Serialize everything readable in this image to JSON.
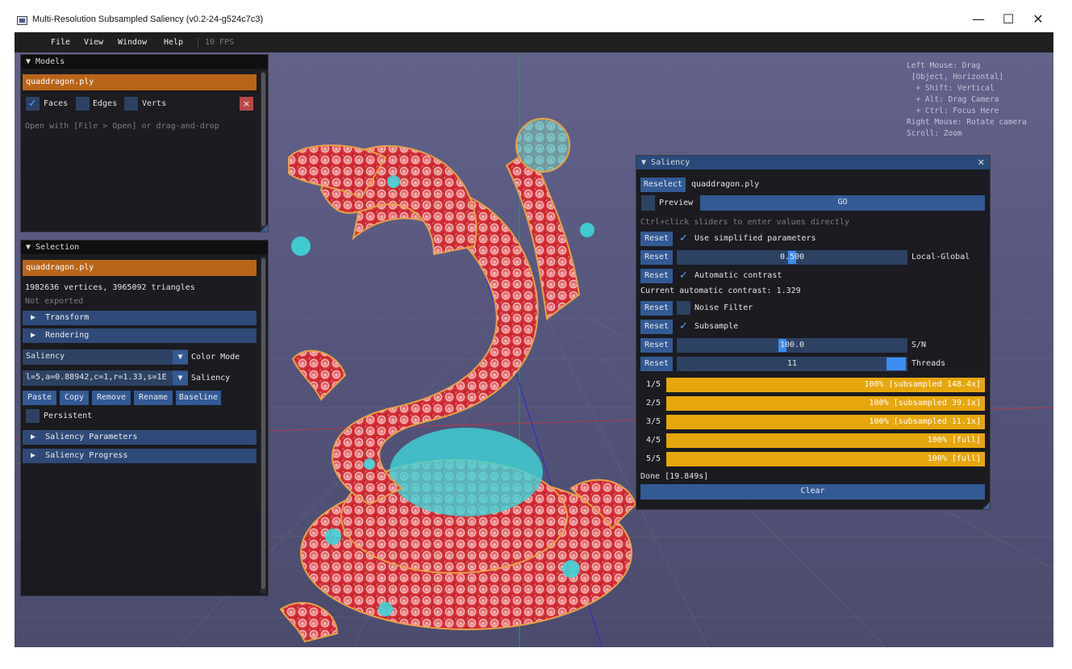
{
  "window": {
    "title": "Multi-Resolution Subsampled Saliency (v0.2-24-g524c7c3)",
    "minimize": "—",
    "maximize": "☐",
    "close": "✕"
  },
  "menu": {
    "items": [
      "File",
      "View",
      "Window",
      "Help"
    ],
    "fps": "10 FPS"
  },
  "help_text": "Left Mouse: Drag\n [Object, Horizontal]\n  + Shift: Vertical\n  + Alt: Drag Camera\n  + Ctrl: Focus Here\nRight Mouse: Rotate camera\nScroll: Zoom",
  "models": {
    "title": "Models",
    "selected_model": "quaddragon.ply",
    "faces": {
      "label": "Faces",
      "checked": true
    },
    "edges": {
      "label": "Edges",
      "checked": false
    },
    "verts": {
      "label": "Verts",
      "checked": false
    },
    "remove_glyph": "×",
    "hint": "Open with [File > Open] or drag-and-drop"
  },
  "selection": {
    "title": "Selection",
    "model": "quaddragon.ply",
    "stats": "1982636 vertices, 3965092 triangles",
    "export_status": "Not exported",
    "transform": "Transform",
    "rendering": "Rendering",
    "color_mode_value": "Saliency",
    "color_mode_label": "Color Mode",
    "saliency_value": "l=5,a=0.88942,c=1,r=1.33,s=1E",
    "saliency_label": "Saliency",
    "buttons": [
      "Paste",
      "Copy",
      "Remove",
      "Rename",
      "Baseline"
    ],
    "persistent": "Persistent",
    "saliency_parameters": "Saliency Parameters",
    "saliency_progress": "Saliency Progress"
  },
  "saliency": {
    "title": "Saliency",
    "reselect": "Reselect",
    "model": "quaddragon.ply",
    "preview": "Preview",
    "go": "GO",
    "hint": "Ctrl+click sliders to enter values directly",
    "reset": "Reset",
    "use_simplified": "Use simplified parameters",
    "local_global_value": "0.500",
    "local_global_fraction": 0.5,
    "local_global_label": "Local-Global",
    "auto_contrast": "Automatic contrast",
    "current_contrast": "Current automatic contrast: 1.329",
    "noise_filter": "Noise Filter",
    "subsample": "Subsample",
    "sn_value": "100.0",
    "sn_label": "S/N",
    "threads_value": "11",
    "threads_label": "Threads",
    "levels": [
      {
        "label": "1/5",
        "text": "100% [subsampled 148.4x]",
        "progress": 1.0
      },
      {
        "label": "2/5",
        "text": "100% [subsampled 39.1x]",
        "progress": 1.0
      },
      {
        "label": "3/5",
        "text": "100% [subsampled 11.1x]",
        "progress": 1.0
      },
      {
        "label": "4/5",
        "text": "100% [full]",
        "progress": 1.0
      },
      {
        "label": "5/5",
        "text": "100% [full]",
        "progress": 1.0
      }
    ],
    "done": "Done [19.849s]",
    "clear": "Clear",
    "close": "✕"
  },
  "colors": {
    "accent": "#e6a60d",
    "highlight": "#b8651a",
    "button": "#335a94"
  }
}
